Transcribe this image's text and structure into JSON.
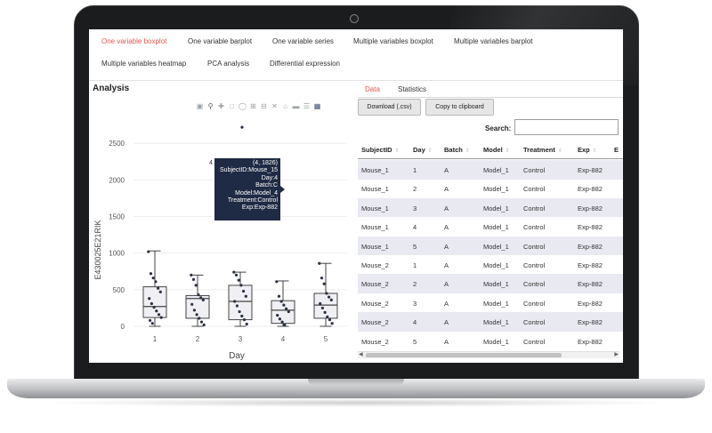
{
  "nav": {
    "items": [
      {
        "label": "One variable boxplot",
        "active": true
      },
      {
        "label": "One variable barplot",
        "active": false
      },
      {
        "label": "One variable series",
        "active": false
      },
      {
        "label": "Multiple variables boxplot",
        "active": false
      },
      {
        "label": "Multiple variables barplot",
        "active": false
      },
      {
        "label": "Multiple variables heatmap",
        "active": false
      },
      {
        "label": "PCA analysis",
        "active": false
      },
      {
        "label": "Differential expression",
        "active": false
      }
    ]
  },
  "left": {
    "title": "Analysis",
    "toolbar_icons": [
      "camera-icon",
      "zoom-icon",
      "pan-icon",
      "box-select-icon",
      "lasso-icon",
      "zoom-in-icon",
      "zoom-out-icon",
      "autoscale-icon",
      "reset-axes-icon",
      "spike-lines-icon",
      "compare-hover-icon",
      "plotly-logo-icon"
    ],
    "tooltip": {
      "tag": "4",
      "lines": [
        "(4, 1826)",
        "SubjectID:Mouse_15",
        "Day:4",
        "Batch:C",
        "Model:Model_4",
        "Treatment:Control",
        "Exp:Exp-882"
      ]
    }
  },
  "chart_data": {
    "type": "box",
    "xlabel": "Day",
    "ylabel": "E430025E21RIK",
    "categories": [
      "1",
      "2",
      "3",
      "4",
      "5"
    ],
    "ylim": [
      0,
      2600
    ],
    "yticks": [
      0,
      500,
      1000,
      1500,
      2000,
      2500
    ],
    "boxes": [
      {
        "x": "1",
        "q1": 120,
        "median": 270,
        "q3": 540,
        "whisker_low": 0,
        "whisker_high": 1030
      },
      {
        "x": "2",
        "q1": 110,
        "median": 380,
        "q3": 420,
        "whisker_low": 0,
        "whisker_high": 700
      },
      {
        "x": "3",
        "q1": 90,
        "median": 340,
        "q3": 560,
        "whisker_low": 0,
        "whisker_high": 740
      },
      {
        "x": "4",
        "q1": 40,
        "median": 220,
        "q3": 350,
        "whisker_low": 0,
        "whisker_high": 620
      },
      {
        "x": "5",
        "q1": 110,
        "median": 290,
        "q3": 450,
        "whisker_low": 0,
        "whisker_high": 860
      }
    ],
    "points": [
      {
        "x": "1",
        "values": [
          1020,
          720,
          660,
          610,
          520,
          470,
          380,
          310,
          260,
          210,
          160,
          120,
          80,
          40
        ]
      },
      {
        "x": "2",
        "values": [
          700,
          640,
          560,
          430,
          390,
          360,
          300,
          220,
          160,
          110,
          60,
          20
        ]
      },
      {
        "x": "3",
        "values": [
          740,
          700,
          630,
          560,
          480,
          410,
          340,
          280,
          200,
          140,
          90,
          30
        ]
      },
      {
        "x": "4",
        "values": [
          610,
          410,
          340,
          290,
          240,
          200,
          150,
          100,
          60,
          20
        ]
      },
      {
        "x": "5",
        "values": [
          860,
          660,
          580,
          450,
          400,
          360,
          310,
          250,
          190,
          130,
          90,
          40
        ]
      }
    ],
    "outlier": {
      "x": "3",
      "value": 2720
    }
  },
  "right": {
    "tabs": [
      {
        "label": "Data",
        "active": true
      },
      {
        "label": "Statistics",
        "active": false
      }
    ],
    "download_label": "Download (.csv)",
    "copy_label": "Copy to clipboard",
    "search_label": "Search:",
    "search_value": "",
    "columns": [
      "SubjectID",
      "Day",
      "Batch",
      "Model",
      "Treatment",
      "Exp",
      "E"
    ],
    "rows": [
      [
        "Mouse_1",
        "1",
        "A",
        "Model_1",
        "Control",
        "Exp-882"
      ],
      [
        "Mouse_1",
        "2",
        "A",
        "Model_1",
        "Control",
        "Exp-882"
      ],
      [
        "Mouse_1",
        "3",
        "A",
        "Model_1",
        "Control",
        "Exp-882"
      ],
      [
        "Mouse_1",
        "4",
        "A",
        "Model_1",
        "Control",
        "Exp-882"
      ],
      [
        "Mouse_1",
        "5",
        "A",
        "Model_1",
        "Control",
        "Exp-882"
      ],
      [
        "Mouse_2",
        "1",
        "A",
        "Model_1",
        "Control",
        "Exp-882"
      ],
      [
        "Mouse_2",
        "2",
        "A",
        "Model_1",
        "Control",
        "Exp-882"
      ],
      [
        "Mouse_2",
        "3",
        "A",
        "Model_1",
        "Control",
        "Exp-882"
      ],
      [
        "Mouse_2",
        "4",
        "A",
        "Model_1",
        "Control",
        "Exp-882"
      ],
      [
        "Mouse_2",
        "5",
        "A",
        "Model_1",
        "Control",
        "Exp-882"
      ]
    ]
  },
  "colors": {
    "accent": "#e0584f",
    "box_fill": "#f0f0f4",
    "box_stroke": "#444444",
    "point": "#2a3142",
    "tooltip_bg": "#1f2a44",
    "row_stripe": "#e9e9f2"
  }
}
